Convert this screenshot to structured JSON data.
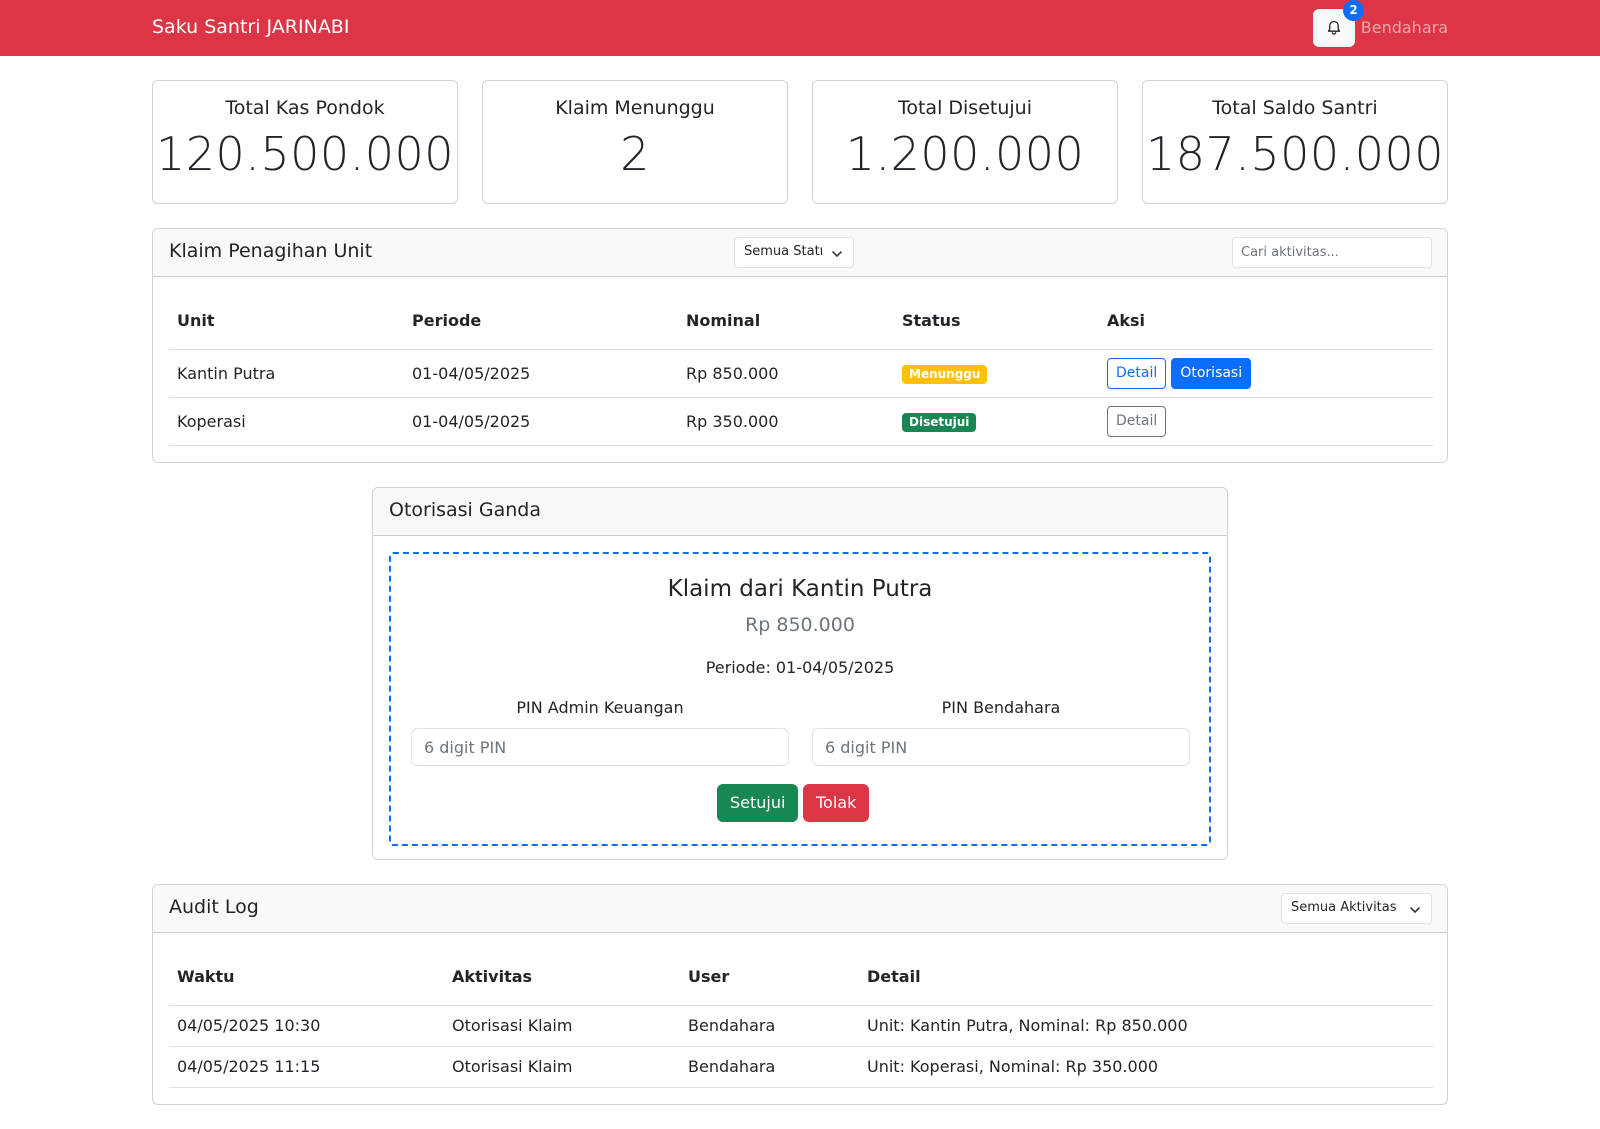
{
  "navbar": {
    "brand": "Saku Santri JARINABI",
    "notification_count": "2",
    "user_label": "Bendahara"
  },
  "stats": [
    {
      "title": "Total Kas Pondok",
      "value": "120.500.000"
    },
    {
      "title": "Klaim Menunggu",
      "value": "2"
    },
    {
      "title": "Total Disetujui",
      "value": "1.200.000"
    },
    {
      "title": "Total Saldo Santri",
      "value": "187.500.000"
    }
  ],
  "claims": {
    "title": "Klaim Penagihan Unit",
    "status_filter": "Semua Statı",
    "search_placeholder": "Cari aktivitas...",
    "columns": [
      "Unit",
      "Periode",
      "Nominal",
      "Status",
      "Aksi"
    ],
    "rows": [
      {
        "unit": "Kantin Putra",
        "period": "01-04/05/2025",
        "amount": "Rp 850.000",
        "status": "Menunggu",
        "detail_label": "Detail",
        "authorize_label": "Otorisasi"
      },
      {
        "unit": "Koperasi",
        "period": "01-04/05/2025",
        "amount": "Rp 350.000",
        "status": "Disetujui",
        "detail_label": "Detail"
      }
    ]
  },
  "authorization": {
    "title": "Otorisasi Ganda",
    "claim_title": "Klaim dari Kantin Putra",
    "amount": "Rp 850.000",
    "period": "Periode: 01-04/05/2025",
    "pin_admin_label": "PIN Admin Keuangan",
    "pin_admin_placeholder": "6 digit PIN",
    "pin_treasurer_label": "PIN Bendahara",
    "pin_treasurer_placeholder": "6 digit PIN",
    "approve_label": "Setujui",
    "reject_label": "Tolak"
  },
  "audit_log": {
    "title": "Audit Log",
    "activity_filter": "Semua Aktivitas",
    "columns": [
      "Waktu",
      "Aktivitas",
      "User",
      "Detail"
    ],
    "rows": [
      {
        "time": "04/05/2025 10:30",
        "activity": "Otorisasi Klaim",
        "user": "Bendahara",
        "detail": "Unit: Kantin Putra, Nominal: Rp 850.000"
      },
      {
        "time": "04/05/2025 11:15",
        "activity": "Otorisasi Klaim",
        "user": "Bendahara",
        "detail": "Unit: Koperasi, Nominal: Rp 350.000"
      }
    ]
  },
  "colors": {
    "navbar": "#dc3545",
    "primary": "#0d6efd",
    "success": "#198754",
    "warning": "#ffc107",
    "danger": "#dc3545"
  },
  "icons": {
    "notifications": "bell-icon",
    "dropdown": "chevron-down-icon"
  }
}
